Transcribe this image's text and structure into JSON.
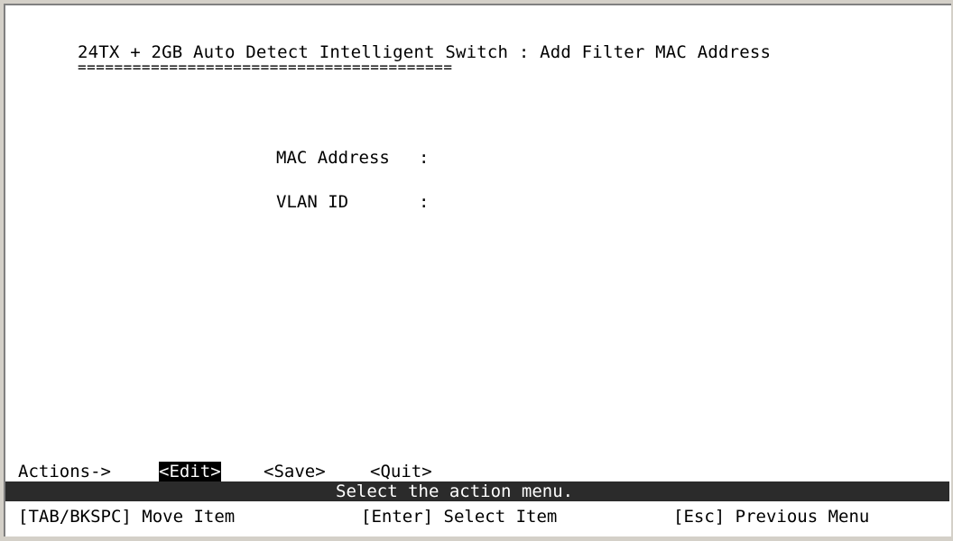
{
  "header": {
    "title": "24TX + 2GB Auto Detect Intelligent Switch : Add Filter MAC Address",
    "underline": "========================================="
  },
  "form": {
    "mac_label": "MAC Address",
    "mac_sep": ":",
    "mac_value": "",
    "vlan_label": "VLAN ID",
    "vlan_sep": ":",
    "vlan_value": ""
  },
  "actions": {
    "label": "Actions->",
    "items": [
      {
        "label": "<Edit>",
        "active": true
      },
      {
        "label": "<Save>",
        "active": false
      },
      {
        "label": "<Quit>",
        "active": false
      }
    ]
  },
  "status": {
    "message": "Select the action menu."
  },
  "help": {
    "items": [
      "[TAB/BKSPC] Move Item",
      "[Enter] Select Item",
      "[Esc] Previous Menu"
    ]
  },
  "colors": {
    "background": "#ffffff",
    "text": "#000000",
    "status_bar": "#2b2b2b",
    "highlight_bg": "#000000",
    "highlight_fg": "#ffffff"
  }
}
